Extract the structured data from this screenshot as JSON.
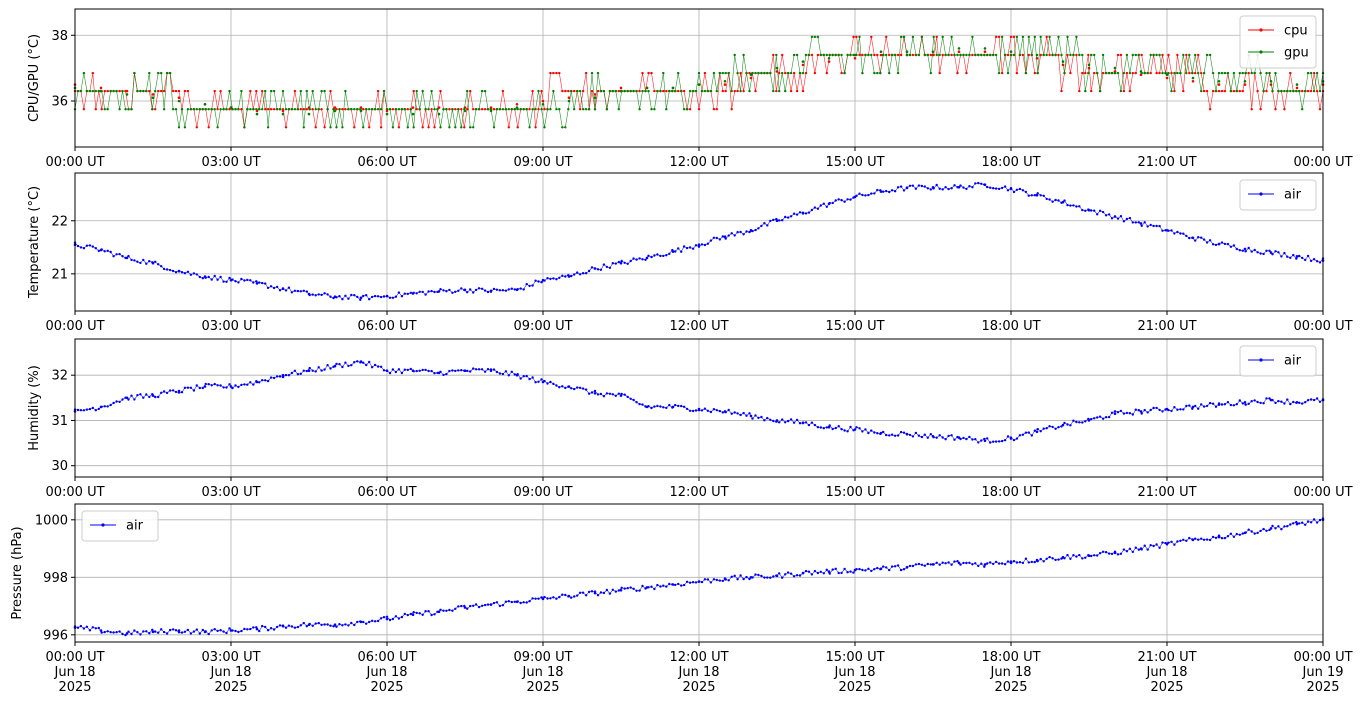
{
  "chart_data": [
    {
      "type": "line",
      "ylabel": "CPU/GPU (°C)",
      "ylim": [
        34.6,
        38.8
      ],
      "yticks": [
        {
          "v": 36,
          "label": "36"
        },
        {
          "v": 38,
          "label": "38"
        }
      ],
      "xticks": [
        "00:00 UT",
        "03:00 UT",
        "06:00 UT",
        "09:00 UT",
        "12:00 UT",
        "15:00 UT",
        "18:00 UT",
        "21:00 UT",
        "00:00 UT"
      ],
      "grid": true,
      "legend_position": "top-right",
      "series": [
        {
          "name": "cpu",
          "color": "#ff0000",
          "x": [
            0,
            0.5,
            1,
            1.5,
            2,
            2.5,
            3,
            3.5,
            4,
            4.5,
            5,
            5.5,
            6,
            6.5,
            7,
            7.5,
            8,
            8.5,
            9,
            9.5,
            10,
            10.5,
            11,
            11.5,
            12,
            12.5,
            13,
            13.5,
            14,
            14.5,
            15,
            15.5,
            16,
            16.5,
            17,
            17.5,
            18,
            18.5,
            19,
            19.5,
            20,
            20.5,
            21,
            21.5,
            22,
            22.5,
            23,
            23.5,
            24
          ],
          "y": [
            36.5,
            36.4,
            36.3,
            36.2,
            36.1,
            35.9,
            35.8,
            35.7,
            35.7,
            35.8,
            35.8,
            35.8,
            35.7,
            35.8,
            35.8,
            35.8,
            35.8,
            35.9,
            36.0,
            36.1,
            36.2,
            36.4,
            36.4,
            36.4,
            36.5,
            36.5,
            36.7,
            36.9,
            37.1,
            37.2,
            37.3,
            37.4,
            37.4,
            37.4,
            37.5,
            37.5,
            37.4,
            37.3,
            37.1,
            37.0,
            36.9,
            36.8,
            36.7,
            36.6,
            36.5,
            36.5,
            36.5,
            36.4,
            36.5
          ]
        },
        {
          "name": "gpu",
          "color": "#008000",
          "x": [
            0,
            0.5,
            1,
            1.5,
            2,
            2.5,
            3,
            3.5,
            4,
            4.5,
            5,
            5.5,
            6,
            6.5,
            7,
            7.5,
            8,
            8.5,
            9,
            9.5,
            10,
            10.5,
            11,
            11.5,
            12,
            12.5,
            13,
            13.5,
            14,
            14.5,
            15,
            15.5,
            16,
            16.5,
            17,
            17.5,
            18,
            18.5,
            19,
            19.5,
            20,
            20.5,
            21,
            21.5,
            22,
            22.5,
            23,
            23.5,
            24
          ],
          "y": [
            36.4,
            36.3,
            36.2,
            36.1,
            36.0,
            35.9,
            35.8,
            35.6,
            35.6,
            35.6,
            35.7,
            35.7,
            35.6,
            35.6,
            35.6,
            35.7,
            35.7,
            35.8,
            35.9,
            36.0,
            36.1,
            36.3,
            36.4,
            36.4,
            36.5,
            36.6,
            36.8,
            37.0,
            37.2,
            37.3,
            37.4,
            37.5,
            37.5,
            37.5,
            37.6,
            37.6,
            37.5,
            37.4,
            37.2,
            37.1,
            37.0,
            36.9,
            36.8,
            36.7,
            36.6,
            36.6,
            36.6,
            36.5,
            36.6
          ]
        }
      ]
    },
    {
      "type": "line",
      "ylabel": "Temperature (°C)",
      "ylim": [
        20.3,
        22.9
      ],
      "yticks": [
        {
          "v": 21,
          "label": "21"
        },
        {
          "v": 22,
          "label": "22"
        }
      ],
      "xticks": [
        "00:00 UT",
        "03:00 UT",
        "06:00 UT",
        "09:00 UT",
        "12:00 UT",
        "15:00 UT",
        "18:00 UT",
        "21:00 UT",
        "00:00 UT"
      ],
      "grid": true,
      "legend_position": "top-right",
      "series": [
        {
          "name": "air",
          "color": "#0000ff",
          "x": [
            0,
            0.5,
            1,
            1.5,
            2,
            2.5,
            3,
            3.5,
            4,
            4.5,
            5,
            5.5,
            6,
            6.5,
            7,
            7.5,
            8,
            8.5,
            9,
            9.5,
            10,
            10.5,
            11,
            11.5,
            12,
            12.5,
            13,
            13.5,
            14,
            14.5,
            15,
            15.5,
            16,
            16.5,
            17,
            17.5,
            18,
            18.5,
            19,
            19.5,
            20,
            20.5,
            21,
            21.5,
            22,
            22.5,
            23,
            23.5,
            24
          ],
          "y": [
            21.55,
            21.45,
            21.3,
            21.2,
            21.05,
            20.95,
            20.88,
            20.82,
            20.72,
            20.62,
            20.57,
            20.55,
            20.58,
            20.63,
            20.67,
            20.7,
            20.68,
            20.7,
            20.88,
            20.95,
            21.1,
            21.2,
            21.3,
            21.42,
            21.55,
            21.7,
            21.82,
            22.0,
            22.15,
            22.32,
            22.45,
            22.55,
            22.62,
            22.63,
            22.63,
            22.68,
            22.6,
            22.48,
            22.35,
            22.2,
            22.08,
            21.95,
            21.82,
            21.68,
            21.56,
            21.47,
            21.4,
            21.33,
            21.25
          ]
        }
      ]
    },
    {
      "type": "line",
      "ylabel": "Humidity (%)",
      "ylim": [
        29.75,
        32.8
      ],
      "yticks": [
        {
          "v": 30,
          "label": "30"
        },
        {
          "v": 31,
          "label": "31"
        },
        {
          "v": 32,
          "label": "32"
        }
      ],
      "xticks": [
        "00:00 UT",
        "03:00 UT",
        "06:00 UT",
        "09:00 UT",
        "12:00 UT",
        "15:00 UT",
        "18:00 UT",
        "21:00 UT",
        "00:00 UT"
      ],
      "grid": true,
      "legend_position": "top-right",
      "series": [
        {
          "name": "air",
          "color": "#0000ff",
          "x": [
            0,
            0.5,
            1,
            1.5,
            2,
            2.5,
            3,
            3.5,
            4,
            4.5,
            5,
            5.5,
            6,
            6.5,
            7,
            7.5,
            8,
            8.5,
            9,
            9.5,
            10,
            10.5,
            11,
            11.5,
            12,
            12.5,
            13,
            13.5,
            14,
            14.5,
            15,
            15.5,
            16,
            16.5,
            17,
            17.5,
            18,
            18.5,
            19,
            19.5,
            20,
            20.5,
            21,
            21.5,
            22,
            22.5,
            23,
            23.5,
            24
          ],
          "y": [
            31.2,
            31.3,
            31.5,
            31.55,
            31.65,
            31.75,
            31.75,
            31.85,
            32.0,
            32.1,
            32.2,
            32.3,
            32.1,
            32.1,
            32.05,
            32.1,
            32.1,
            32.0,
            31.85,
            31.75,
            31.6,
            31.55,
            31.3,
            31.3,
            31.25,
            31.2,
            31.1,
            31.0,
            30.95,
            30.85,
            30.8,
            30.72,
            30.7,
            30.65,
            30.62,
            30.55,
            30.6,
            30.75,
            30.9,
            31.0,
            31.15,
            31.2,
            31.25,
            31.3,
            31.35,
            31.4,
            31.45,
            31.4,
            31.45
          ]
        }
      ]
    },
    {
      "type": "line",
      "ylabel": "Pressure (hPa)",
      "ylim": [
        995.75,
        1000.55
      ],
      "yticks": [
        {
          "v": 996,
          "label": "996"
        },
        {
          "v": 998,
          "label": "998"
        },
        {
          "v": 1000,
          "label": "1000"
        }
      ],
      "xticks": [
        "00:00 UT\nJun 18\n2025",
        "03:00 UT\nJun 18\n2025",
        "06:00 UT\nJun 18\n2025",
        "09:00 UT\nJun 18\n2025",
        "12:00 UT\nJun 18\n2025",
        "15:00 UT\nJun 18\n2025",
        "18:00 UT\nJun 18\n2025",
        "21:00 UT\nJun 18\n2025",
        "00:00 UT\nJun 19\n2025"
      ],
      "grid": true,
      "legend_position": "top-left",
      "series": [
        {
          "name": "air",
          "color": "#0000ff",
          "x": [
            0,
            0.5,
            1,
            1.5,
            2,
            2.5,
            3,
            3.5,
            4,
            4.5,
            5,
            5.5,
            6,
            6.5,
            7,
            7.5,
            8,
            8.5,
            9,
            9.5,
            10,
            10.5,
            11,
            11.5,
            12,
            12.5,
            13,
            13.5,
            14,
            14.5,
            15,
            15.5,
            16,
            16.5,
            17,
            17.5,
            18,
            18.5,
            19,
            19.5,
            20,
            20.5,
            21,
            21.5,
            22,
            22.5,
            23,
            23.5,
            24
          ],
          "y": [
            996.25,
            996.15,
            996.05,
            996.1,
            996.15,
            996.1,
            996.15,
            996.2,
            996.3,
            996.35,
            996.35,
            996.45,
            996.55,
            996.7,
            996.8,
            996.95,
            997.05,
            997.15,
            997.25,
            997.35,
            997.45,
            997.55,
            997.65,
            997.75,
            997.85,
            997.95,
            998.0,
            998.05,
            998.15,
            998.2,
            998.25,
            998.3,
            998.35,
            998.45,
            998.5,
            998.45,
            998.55,
            998.6,
            998.7,
            998.75,
            998.85,
            999.0,
            999.15,
            999.3,
            999.4,
            999.55,
            999.7,
            999.85,
            1000.0
          ]
        }
      ]
    }
  ]
}
